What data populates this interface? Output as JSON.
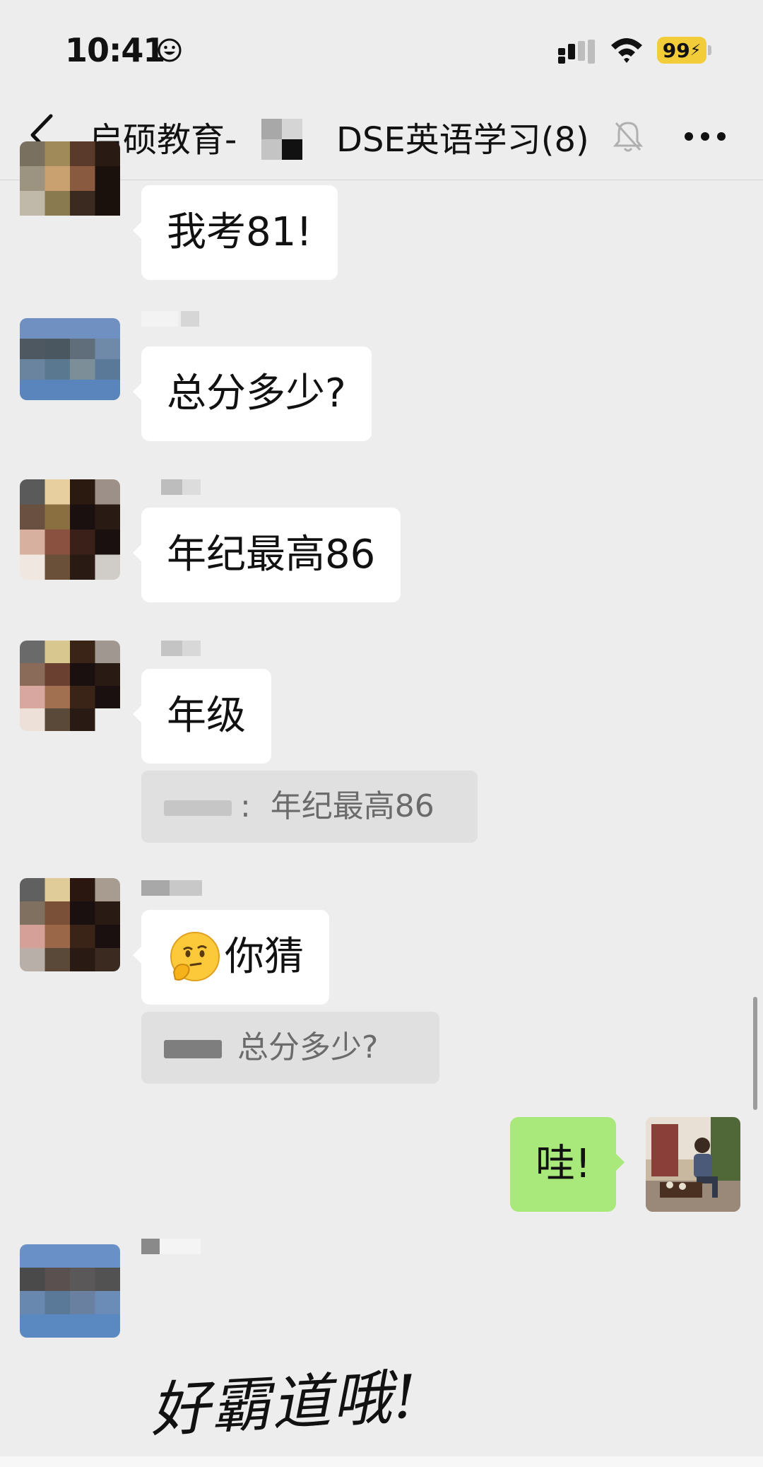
{
  "status_bar": {
    "time": "10:41",
    "battery": "99"
  },
  "nav": {
    "title_prefix": "启硕教育-",
    "title_suffix": "DSE英语学习(8)",
    "icons": [
      "back-arrow-icon",
      "mute-bell-icon",
      "more-dots-icon"
    ]
  },
  "messages": [
    {
      "from": "other",
      "text": "我考81!"
    },
    {
      "from": "other",
      "text": "总分多少?"
    },
    {
      "from": "other",
      "text": "年纪最高86"
    },
    {
      "from": "other",
      "text": "年级",
      "quote": "年纪最高86"
    },
    {
      "from": "other",
      "text": "你猜",
      "emoji": "thinking-face-hand-emoji",
      "quote": "总分多少?"
    },
    {
      "from": "me",
      "text": "哇!"
    },
    {
      "from": "other",
      "sticker": "好霸道哦!"
    }
  ],
  "colors": {
    "background": "#ededed",
    "bubble_other": "#ffffff",
    "bubble_me": "#a9e87a",
    "battery": "#f3cd39"
  }
}
